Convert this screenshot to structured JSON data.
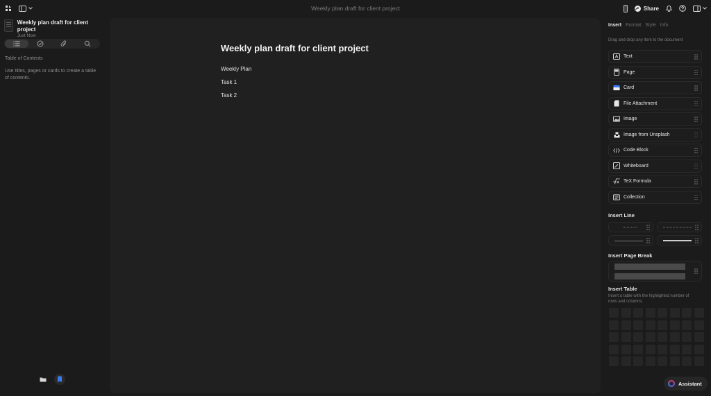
{
  "window": {
    "title": "Weekly plan draft for client project"
  },
  "topbar": {
    "share_label": "Share"
  },
  "sidebar": {
    "doc_title": "Weekly plan draft for client project",
    "doc_time": "Just Now",
    "tabs": [
      "list-icon",
      "check-circle-icon",
      "paperclip-icon",
      "search-icon"
    ],
    "toc_label": "Table of Contents",
    "toc_help": "Use titles, pages or cards to create a table of contents."
  },
  "editor": {
    "title": "Weekly plan draft for client project",
    "lines": [
      "Weekly Plan",
      "Task 1",
      "Task 2"
    ]
  },
  "panel": {
    "tabs": [
      "Insert",
      "Format",
      "Style",
      "Info"
    ],
    "subtitle": "Drag and drop any item to the document",
    "items": [
      {
        "label": "Text",
        "icon": "text-icon"
      },
      {
        "label": "Page",
        "icon": "page-icon"
      },
      {
        "label": "Card",
        "icon": "card-icon"
      },
      {
        "label": "File Attachment",
        "icon": "file-icon"
      },
      {
        "label": "Image",
        "icon": "image-icon"
      },
      {
        "label": "Image from Unsplash",
        "icon": "unsplash-icon"
      },
      {
        "label": "Code Block",
        "icon": "code-icon"
      },
      {
        "label": "Whiteboard",
        "icon": "whiteboard-icon"
      },
      {
        "label": "TeX Formula",
        "icon": "formula-icon"
      },
      {
        "label": "Collection",
        "icon": "collection-icon"
      }
    ],
    "insert_line_title": "Insert Line",
    "insert_page_break_title": "Insert Page Break",
    "insert_table_title": "Insert Table",
    "insert_table_sub": "Insert a table with the highlighted number of rows and columns."
  },
  "assistant": {
    "label": "Assistant"
  },
  "colors": {
    "background": "#1b1b1b",
    "editor": "#202020",
    "accent": "#3a7bf0"
  }
}
